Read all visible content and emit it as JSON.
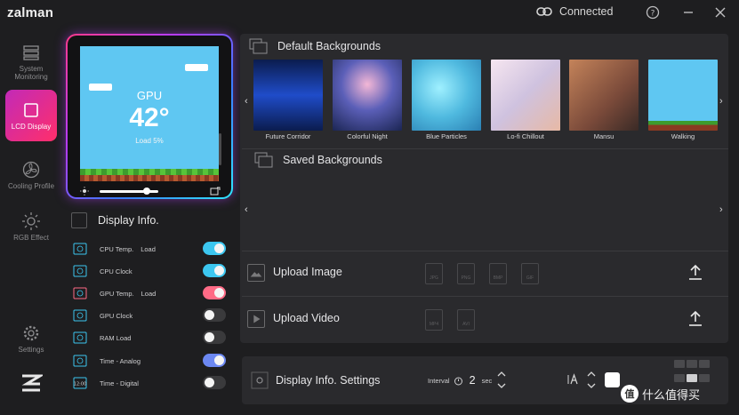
{
  "app": {
    "brand": "zalman",
    "status": "Connected"
  },
  "sidebar": {
    "items": [
      {
        "label": "System Monitoring",
        "icon": "system-monitoring-icon",
        "active": false
      },
      {
        "label": "LCD Display",
        "icon": "lcd-display-icon",
        "active": true
      },
      {
        "label": "Cooling Profile",
        "icon": "fan-icon",
        "active": false
      },
      {
        "label": "RGB Effect",
        "icon": "rgb-sun-icon",
        "active": false
      },
      {
        "label": "Settings",
        "icon": "gear-icon",
        "active": false
      }
    ]
  },
  "preview": {
    "label": "GPU",
    "value": "42°",
    "load": "Load 5%",
    "brightness": 0.8
  },
  "display_info": {
    "title": "Display Info.",
    "items": [
      {
        "name": "CPU Temp.",
        "extra": "Load",
        "on": true,
        "color": "#3cc7f0"
      },
      {
        "name": "CPU Clock",
        "extra": "",
        "on": true,
        "color": "#3cc7f0"
      },
      {
        "name": "GPU Temp.",
        "extra": "Load",
        "on": true,
        "color": "#ff6b86"
      },
      {
        "name": "GPU Clock",
        "extra": "",
        "on": false,
        "color": "#3a3a3c"
      },
      {
        "name": "RAM Load",
        "extra": "",
        "on": false,
        "color": "#3a3a3c"
      },
      {
        "name": "Time - Analog",
        "extra": "",
        "on": true,
        "color": "#6c88f2"
      },
      {
        "name": "Time - Digital",
        "extra": "",
        "on": false,
        "color": "#3a3a3c"
      }
    ],
    "digital_icon_text": "12:00"
  },
  "backgrounds": {
    "default_title": "Default Backgrounds",
    "saved_title": "Saved Backgrounds",
    "items": [
      {
        "name": "Future Corridor",
        "color": "#1b3a8a"
      },
      {
        "name": "Colorful Night",
        "color": "#3b4f8e"
      },
      {
        "name": "Blue Particles",
        "color": "#5ecbe6"
      },
      {
        "name": "Lo-fi Chillout",
        "color": "#d9cbe0"
      },
      {
        "name": "Mansu",
        "color": "#8a5a48"
      },
      {
        "name": "Walking",
        "color": "#5fc7f2"
      }
    ]
  },
  "upload": {
    "image_label": "Upload Image",
    "video_label": "Upload Video",
    "image_formats": [
      "JPG",
      "PNG",
      "BMP",
      "GIF"
    ],
    "video_formats": [
      "MP4",
      "AVI"
    ]
  },
  "settings_bar": {
    "title": "Display Info. Settings",
    "interval_label": "Interval",
    "interval_value": "2",
    "interval_unit": "sec",
    "font_size_icon": "font-size-icon",
    "text_color": "#ffffff"
  },
  "watermark": {
    "badge": "值",
    "text": "什么值得买"
  },
  "colors": {
    "accent_pink": "#ff2f6a",
    "accent_purple": "#c22ab8",
    "toggle_blue": "#3cc7f0"
  }
}
